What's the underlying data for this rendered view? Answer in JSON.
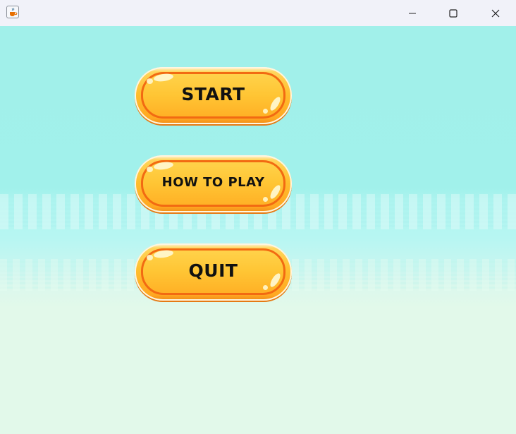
{
  "window": {
    "app_icon": "java-cup-icon",
    "controls": {
      "minimize_icon": "minimize-icon",
      "maximize_icon": "maximize-icon",
      "close_icon": "close-icon"
    }
  },
  "menu": {
    "start_label": "START",
    "how_to_play_label": "HOW TO PLAY",
    "quit_label": "QUIT"
  },
  "colors": {
    "sky": "#a1f0ea",
    "ground": "#e2f9ea",
    "button_fill": "#ffc534",
    "button_outline": "#f26a12",
    "label": "#111111"
  }
}
